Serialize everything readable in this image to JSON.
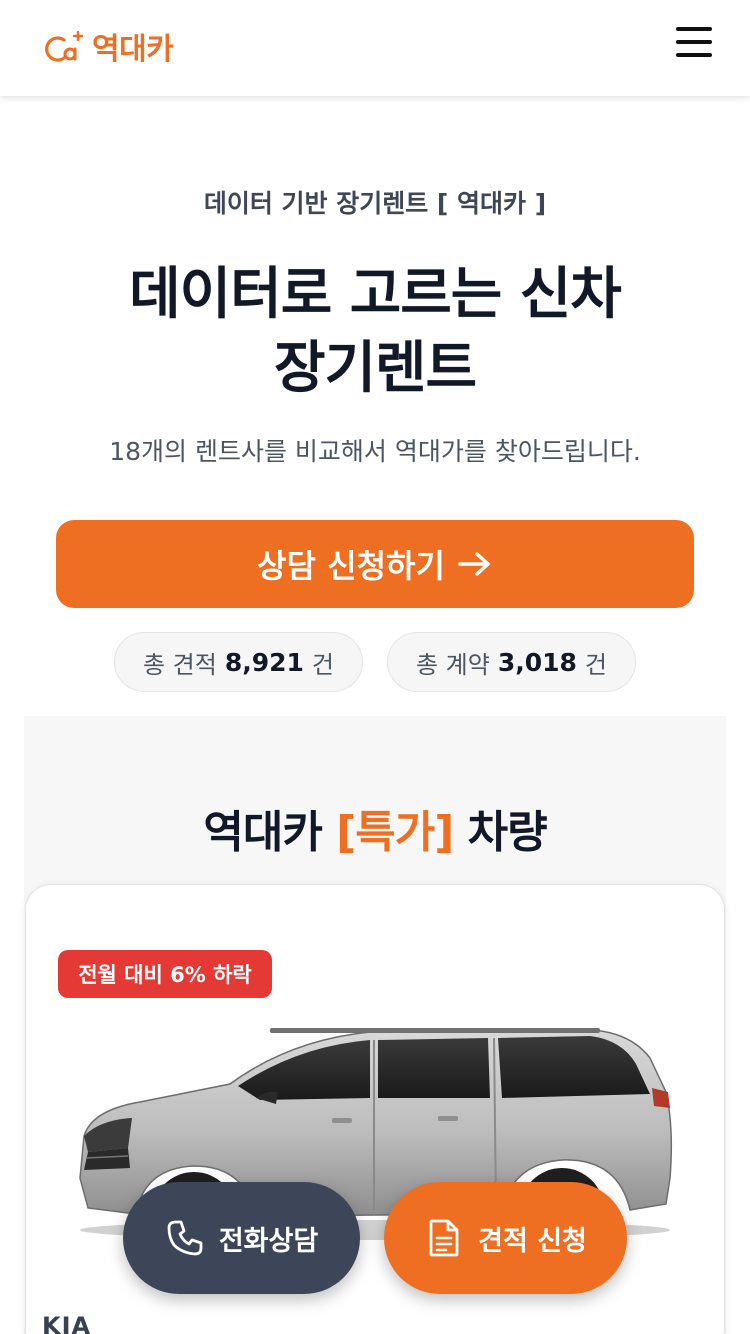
{
  "header": {
    "logo_text": "역대카",
    "logo_icon": "car-logo-icon",
    "menu_icon": "hamburger-menu-icon"
  },
  "hero": {
    "eyebrow": "데이터 기반 장기렌트 [ 역대카 ]",
    "headline_line1": "데이터로 고르는 신차",
    "headline_line2": "장기렌트",
    "subcopy": "18개의 렌트사를 비교해서 역대가를 찾아드립니다.",
    "cta_label": "상담 신청하기"
  },
  "stats": {
    "quotes_prefix": "총 견적",
    "quotes_value": "8,921",
    "quotes_unit": "건",
    "contracts_prefix": "총 계약",
    "contracts_value": "3,018",
    "contracts_unit": "건"
  },
  "special": {
    "title_prefix": "역대카",
    "title_accent": "[특가]",
    "title_suffix": "차량",
    "card": {
      "badge": "전월 대비 6% 하락",
      "brand": "KIA"
    }
  },
  "floating": {
    "call_label": "전화상담",
    "quote_label": "견적 신청"
  },
  "colors": {
    "brand_orange": "#ee6f22",
    "navy": "#3c4658",
    "badge_red": "#e53935"
  }
}
